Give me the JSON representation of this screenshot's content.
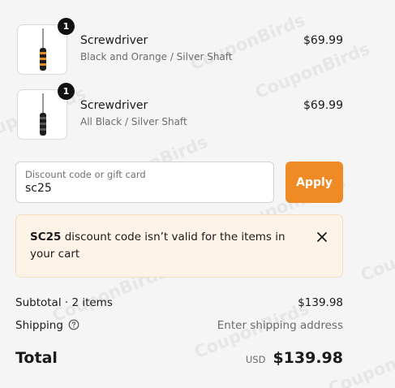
{
  "items": [
    {
      "quantity": "1",
      "name": "Screwdriver",
      "variant": "Black and Orange / Silver Shaft",
      "price": "$69.99"
    },
    {
      "quantity": "1",
      "name": "Screwdriver",
      "variant": "All Black / Silver Shaft",
      "price": "$69.99"
    }
  ],
  "discount": {
    "label": "Discount code or gift card",
    "value": "sc25",
    "apply_label": "Apply"
  },
  "error": {
    "code": "SC25",
    "message": " discount code isn’t valid for the items in your cart"
  },
  "summary": {
    "subtotal_label": "Subtotal · 2 items",
    "subtotal_value": "$139.98",
    "shipping_label": "Shipping",
    "shipping_value": "Enter shipping address",
    "total_label": "Total",
    "currency": "USD",
    "total_value": "$139.98"
  },
  "watermark": "CouponBirds",
  "colors": {
    "accent": "#f08a24",
    "error_bg": "#fdf3e7"
  }
}
